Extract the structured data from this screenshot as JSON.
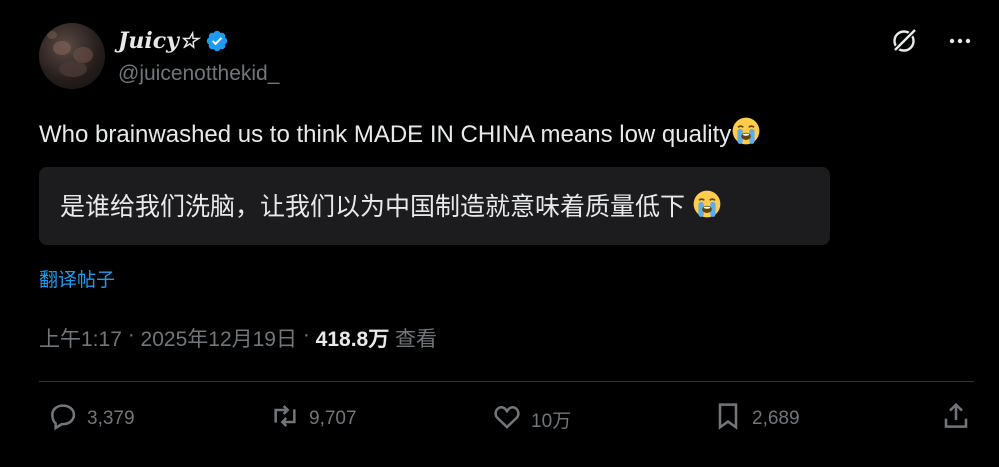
{
  "author": {
    "display_name": "Juicy☆",
    "handle": "@juicenotthekid_",
    "verified": true
  },
  "tweet": {
    "text": "Who brainwashed us to think MADE IN CHINA means low quality",
    "emoji": "loudly-crying-face",
    "translation": "是谁给我们洗脑，让我们以为中国制造就意味着质量低下",
    "translate_link": "翻译帖子"
  },
  "meta": {
    "time": "上午1:17",
    "sep1": " · ",
    "date": "2025年12月19日",
    "sep2": " · ",
    "views": "418.8万",
    "views_label": " 查看"
  },
  "actions": {
    "replies": "3,379",
    "reposts": "9,707",
    "likes": "10万",
    "bookmarks": "2,689"
  },
  "colors": {
    "background": "#000000",
    "text": "#e7e9ea",
    "muted": "#71767b",
    "link": "#1d9bf0",
    "verified": "#1d9bf0",
    "translation_bg": "#1c1c1e",
    "divider": "#2f3336"
  }
}
